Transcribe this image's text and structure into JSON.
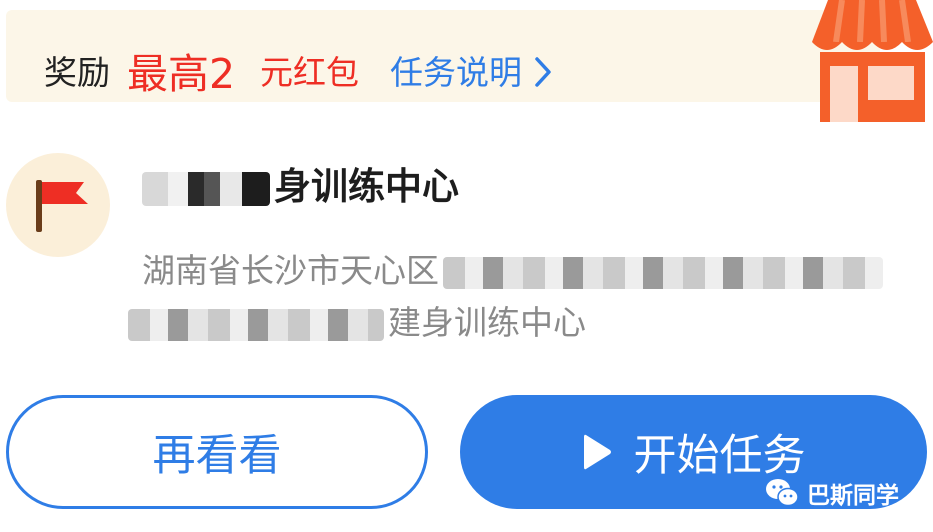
{
  "reward": {
    "prefix": "奖励",
    "highlight": "最高2",
    "suffix": "元红包",
    "task_info_link": "任务说明"
  },
  "icons": {
    "shop": "storefront-icon",
    "flag": "red-flag-icon",
    "chevron": "chevron-right-icon",
    "play": "play-icon",
    "wechat": "wechat-icon"
  },
  "place": {
    "name": "身训练中心",
    "address_line1": "湖南省长沙市天心区",
    "address_line2": "建身训练中心"
  },
  "actions": {
    "browse_again": "再看看",
    "start_task": "开始任务"
  },
  "watermark": {
    "text": "巴斯同学"
  },
  "colors": {
    "accent_blue": "#2f7de6",
    "reward_red": "#ee2e24",
    "banner_bg": "#fcf6e8",
    "shop_orange": "#f4602a"
  }
}
